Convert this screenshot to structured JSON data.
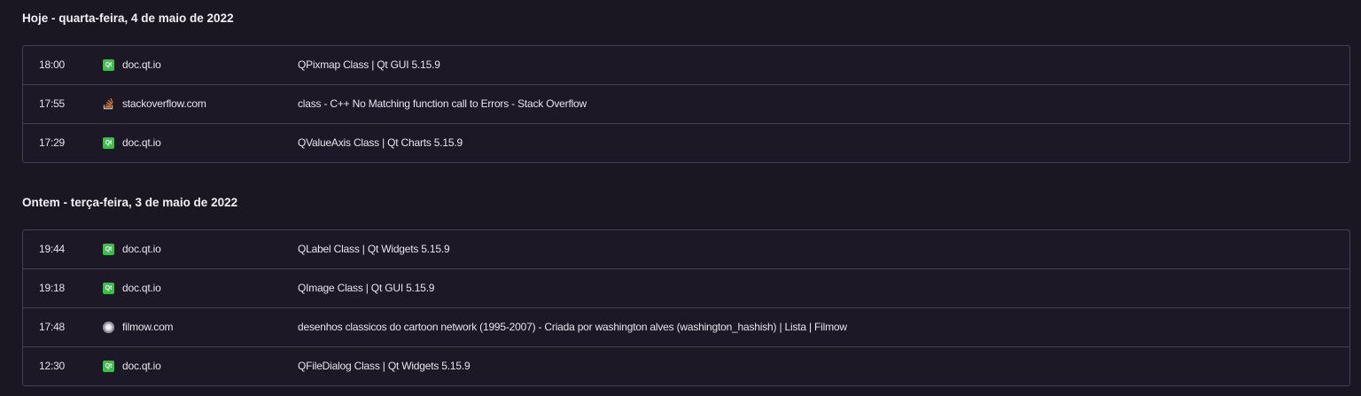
{
  "groups": [
    {
      "title": "Hoje - quarta-feira, 4 de maio de 2022",
      "items": [
        {
          "time": "18:00",
          "favicon": "qt-icon",
          "domain": "doc.qt.io",
          "title": "QPixmap Class | Qt GUI 5.15.9"
        },
        {
          "time": "17:55",
          "favicon": "stackoverflow-icon",
          "domain": "stackoverflow.com",
          "title": "class - C++ No Matching function call to Errors - Stack Overflow"
        },
        {
          "time": "17:29",
          "favicon": "qt-icon",
          "domain": "doc.qt.io",
          "title": "QValueAxis Class | Qt Charts 5.15.9"
        }
      ]
    },
    {
      "title": "Ontem - terça-feira, 3 de maio de 2022",
      "items": [
        {
          "time": "19:44",
          "favicon": "qt-icon",
          "domain": "doc.qt.io",
          "title": "QLabel Class | Qt Widgets 5.15.9"
        },
        {
          "time": "19:18",
          "favicon": "qt-icon",
          "domain": "doc.qt.io",
          "title": "QImage Class | Qt GUI 5.15.9"
        },
        {
          "time": "17:48",
          "favicon": "filmow-icon",
          "domain": "filmow.com",
          "title": "desenhos classicos do cartoon network (1995-2007) - Criada por washington alves (washington_hashish) | Lista | Filmow"
        },
        {
          "time": "12:30",
          "favicon": "qt-icon",
          "domain": "doc.qt.io",
          "title": "QFileDialog Class | Qt Widgets 5.15.9"
        }
      ]
    }
  ],
  "colors": {
    "background": "#1a1622",
    "border": "#45404f",
    "text": "#e6e4ec",
    "qt_green": "#3bbf4a",
    "stackoverflow_orange": "#f48024"
  }
}
